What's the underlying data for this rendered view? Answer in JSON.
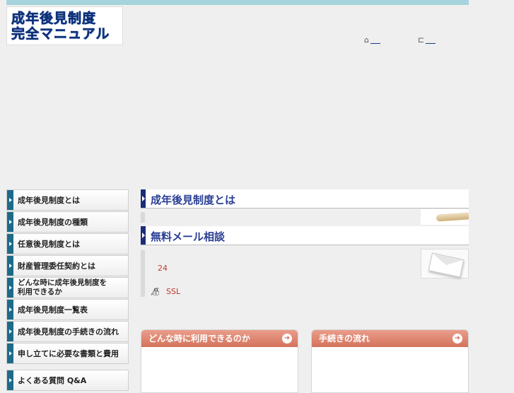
{
  "logo": {
    "line1": "成年後見制度",
    "line2": "完全マニュアル"
  },
  "header": {
    "home_link": {
      "icon": "home-icon",
      "label": ""
    },
    "sitemap_link": {
      "icon": "sitemap-icon",
      "label": ""
    }
  },
  "sidebar": {
    "items": [
      {
        "label": "成年後見制度とは"
      },
      {
        "label": "成年後見制度の種類"
      },
      {
        "label": "任意後見制度とは"
      },
      {
        "label": "財産管理委任契約とは"
      },
      {
        "label_line1": "どんな時に成年後見制度を",
        "label_line2": "利用できるか"
      },
      {
        "label": "成年後見制度一覧表"
      },
      {
        "label": "成年後見制度の手続きの流れ"
      },
      {
        "label": "申し立てに必要な書類と費用"
      }
    ],
    "faq": {
      "label": "よくある質問 Q&A"
    }
  },
  "main": {
    "section1": {
      "title": "成年後見制度とは"
    },
    "section2": {
      "title": "無料メール相談",
      "hours": "24",
      "ssl": "SSL"
    },
    "cards": [
      {
        "title": "どんな時に利用できるのか"
      },
      {
        "title": "手続きの流れ"
      }
    ]
  },
  "colors": {
    "accent": "#1c2d77",
    "topbar": "#a6d3dc",
    "card_header": "#d4735c",
    "link_red": "#c0392b"
  }
}
